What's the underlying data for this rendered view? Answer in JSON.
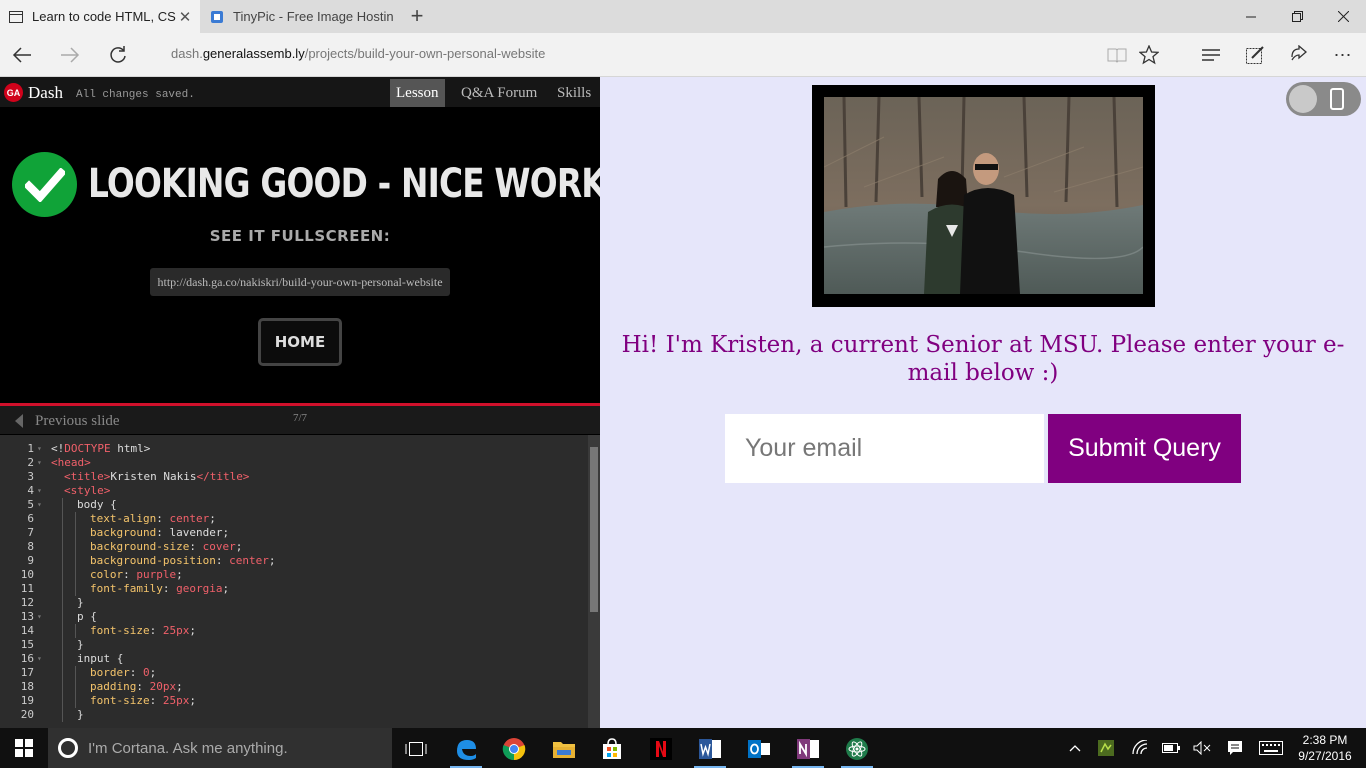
{
  "browser": {
    "tabs": [
      {
        "title": "Learn to code HTML, CS",
        "active": true
      },
      {
        "title": "TinyPic - Free Image Hostin",
        "active": false
      }
    ],
    "address": {
      "prefix": "dash.",
      "host": "generalassemb.ly",
      "path": "/projects/build-your-own-personal-website"
    }
  },
  "dash": {
    "logo": "GA",
    "brand": "Dash",
    "saved_status": "All changes saved.",
    "nav": [
      "Lesson",
      "Q&A Forum",
      "Skills"
    ],
    "active_nav": "Lesson",
    "success_title": "LOOKING GOOD - NICE WORK!",
    "fullscreen_label": "SEE IT FULLSCREEN:",
    "fullscreen_url": "http://dash.ga.co/nakiskri/build-your-own-personal-website",
    "home_label": "HOME",
    "prev_slide_label": "Previous slide",
    "slide_counter": "7/7",
    "accent_color": "#d0102b",
    "success_color": "#10a338"
  },
  "code": {
    "lines": [
      {
        "n": "1",
        "fold": "▾",
        "indent": 0,
        "tokens": [
          [
            "plain",
            "<!"
          ],
          [
            "tag",
            "DOCTYPE"
          ],
          [
            "plain",
            " html>"
          ]
        ]
      },
      {
        "n": "2",
        "fold": "▾",
        "indent": 0,
        "tokens": [
          [
            "tag",
            "<head>"
          ]
        ]
      },
      {
        "n": "3",
        "fold": "",
        "indent": 1,
        "tokens": [
          [
            "tag",
            "<title>"
          ],
          [
            "plain",
            "Kristen Nakis"
          ],
          [
            "tag",
            "</title>"
          ]
        ]
      },
      {
        "n": "4",
        "fold": "▾",
        "indent": 1,
        "tokens": [
          [
            "tag",
            "<style>"
          ]
        ]
      },
      {
        "n": "5",
        "fold": "▾",
        "indent": 2,
        "tokens": [
          [
            "plain",
            "body {"
          ]
        ]
      },
      {
        "n": "6",
        "fold": "",
        "indent": 3,
        "tokens": [
          [
            "prop",
            "text-align"
          ],
          [
            "plain",
            ": "
          ],
          [
            "val",
            "center"
          ],
          [
            "plain",
            ";"
          ]
        ]
      },
      {
        "n": "7",
        "fold": "",
        "indent": 3,
        "tokens": [
          [
            "prop",
            "background"
          ],
          [
            "plain",
            ": lavender;"
          ]
        ]
      },
      {
        "n": "8",
        "fold": "",
        "indent": 3,
        "tokens": [
          [
            "prop",
            "background-size"
          ],
          [
            "plain",
            ": "
          ],
          [
            "val",
            "cover"
          ],
          [
            "plain",
            ";"
          ]
        ]
      },
      {
        "n": "9",
        "fold": "",
        "indent": 3,
        "tokens": [
          [
            "prop",
            "background-position"
          ],
          [
            "plain",
            ": "
          ],
          [
            "val",
            "center"
          ],
          [
            "plain",
            ";"
          ]
        ]
      },
      {
        "n": "10",
        "fold": "",
        "indent": 3,
        "tokens": [
          [
            "prop",
            "color"
          ],
          [
            "plain",
            ": "
          ],
          [
            "val",
            "purple"
          ],
          [
            "plain",
            ";"
          ]
        ]
      },
      {
        "n": "11",
        "fold": "",
        "indent": 3,
        "tokens": [
          [
            "prop",
            "font-family"
          ],
          [
            "plain",
            ": "
          ],
          [
            "val",
            "georgia"
          ],
          [
            "plain",
            ";"
          ]
        ]
      },
      {
        "n": "12",
        "fold": "",
        "indent": 2,
        "tokens": [
          [
            "plain",
            "}"
          ]
        ]
      },
      {
        "n": "13",
        "fold": "▾",
        "indent": 2,
        "tokens": [
          [
            "plain",
            "p {"
          ]
        ]
      },
      {
        "n": "14",
        "fold": "",
        "indent": 3,
        "tokens": [
          [
            "prop",
            "font-size"
          ],
          [
            "plain",
            ": "
          ],
          [
            "num",
            "25"
          ],
          [
            "val",
            "px"
          ],
          [
            "plain",
            ";"
          ]
        ]
      },
      {
        "n": "15",
        "fold": "",
        "indent": 2,
        "tokens": [
          [
            "plain",
            "}"
          ]
        ]
      },
      {
        "n": "16",
        "fold": "▾",
        "indent": 2,
        "tokens": [
          [
            "plain",
            "input {"
          ]
        ]
      },
      {
        "n": "17",
        "fold": "",
        "indent": 3,
        "tokens": [
          [
            "prop",
            "border"
          ],
          [
            "plain",
            ": "
          ],
          [
            "num",
            "0"
          ],
          [
            "plain",
            ";"
          ]
        ]
      },
      {
        "n": "18",
        "fold": "",
        "indent": 3,
        "tokens": [
          [
            "prop",
            "padding"
          ],
          [
            "plain",
            ": "
          ],
          [
            "num",
            "20"
          ],
          [
            "val",
            "px"
          ],
          [
            "plain",
            ";"
          ]
        ]
      },
      {
        "n": "19",
        "fold": "",
        "indent": 3,
        "tokens": [
          [
            "prop",
            "font-size"
          ],
          [
            "plain",
            ": "
          ],
          [
            "num",
            "25"
          ],
          [
            "val",
            "px"
          ],
          [
            "plain",
            ";"
          ]
        ]
      },
      {
        "n": "20",
        "fold": "",
        "indent": 2,
        "tokens": [
          [
            "plain",
            "}"
          ]
        ]
      }
    ]
  },
  "preview": {
    "intro_text": "Hi! I'm Kristen, a current Senior at MSU. Please enter your e-mail below :)",
    "email_placeholder": "Your email",
    "submit_label": "Submit Query",
    "text_color": "#800080",
    "background_color": "#e6e6fa"
  },
  "taskbar": {
    "cortana_placeholder": "I'm Cortana. Ask me anything.",
    "time": "2:38 PM",
    "date": "9/27/2016"
  }
}
